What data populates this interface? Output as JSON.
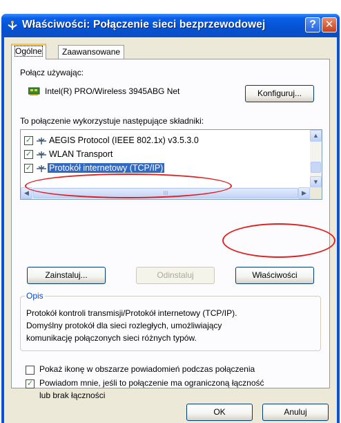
{
  "window": {
    "title": "Właściwości: Połączenie sieci bezprzewodowej",
    "help_glyph": "?",
    "close_glyph": "✕"
  },
  "tabs": [
    {
      "label": "Ogólne",
      "active": true
    },
    {
      "label": "Zaawansowane",
      "active": false
    }
  ],
  "general": {
    "connect_using_label": "Połącz używając:",
    "adapter_name": "Intel(R) PRO/Wireless 3945ABG Net",
    "configure_button": "Konfiguruj...",
    "components_label": "To połączenie wykorzystuje następujące składniki:",
    "components": [
      {
        "label": "AEGIS Protocol (IEEE 802.1x) v3.5.3.0",
        "checked": true,
        "selected": false
      },
      {
        "label": "WLAN Transport",
        "checked": true,
        "selected": false
      },
      {
        "label": "Protokół internetowy (TCP/IP)",
        "checked": true,
        "selected": true
      }
    ],
    "scroll_thumb_marker": "III",
    "install_button": "Zainstaluj...",
    "uninstall_button": "Odinstaluj",
    "properties_button": "Właściwości",
    "description_title": "Opis",
    "description_lines": [
      "Protokół kontroli transmisji/Protokół internetowy (TCP/IP).",
      "Domyślny protokół dla sieci rozległych, umożliwiający",
      "komunikację połączonych sieci różnych typów."
    ],
    "show_icon_checkbox": {
      "label": "Pokaż ikonę w obszarze powiadomień podczas połączenia",
      "checked": false
    },
    "notify_checkbox": {
      "label_line1": "Powiadom mnie, jeśli to połączenie ma ograniczoną łączność",
      "label_line2": "lub brak łączności",
      "checked": true
    }
  },
  "footer": {
    "ok_button": "OK",
    "cancel_button": "Anuluj"
  },
  "colors": {
    "titlebar": "#0653d4",
    "dialog_bg": "#ece9d8",
    "selection": "#316ac5",
    "annotation": "#e02020"
  },
  "icons": {
    "title": "network-connection-icon",
    "adapter": "network-card-icon",
    "protocol": "network-protocol-icon"
  }
}
